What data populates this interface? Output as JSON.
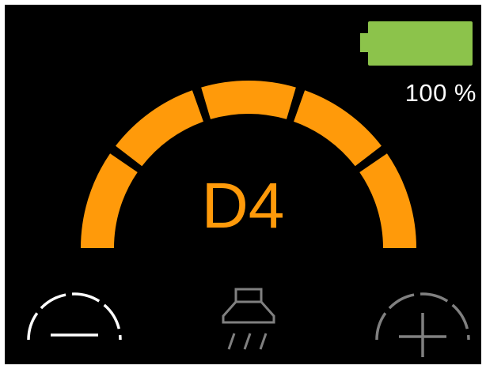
{
  "battery": {
    "level_percent": 100,
    "label": "100 %",
    "fill_color": "#8cc34b"
  },
  "power_level": {
    "label": "D4",
    "segments_total": 5,
    "segments_active": 5,
    "color": "#ff9a0a"
  },
  "controls": {
    "decrease": {
      "icon": "minus-icon",
      "color": "#ffffff"
    },
    "mode": {
      "icon": "extractor-hood-icon",
      "color": "#808080"
    },
    "increase": {
      "icon": "plus-icon",
      "color": "#808080"
    }
  }
}
